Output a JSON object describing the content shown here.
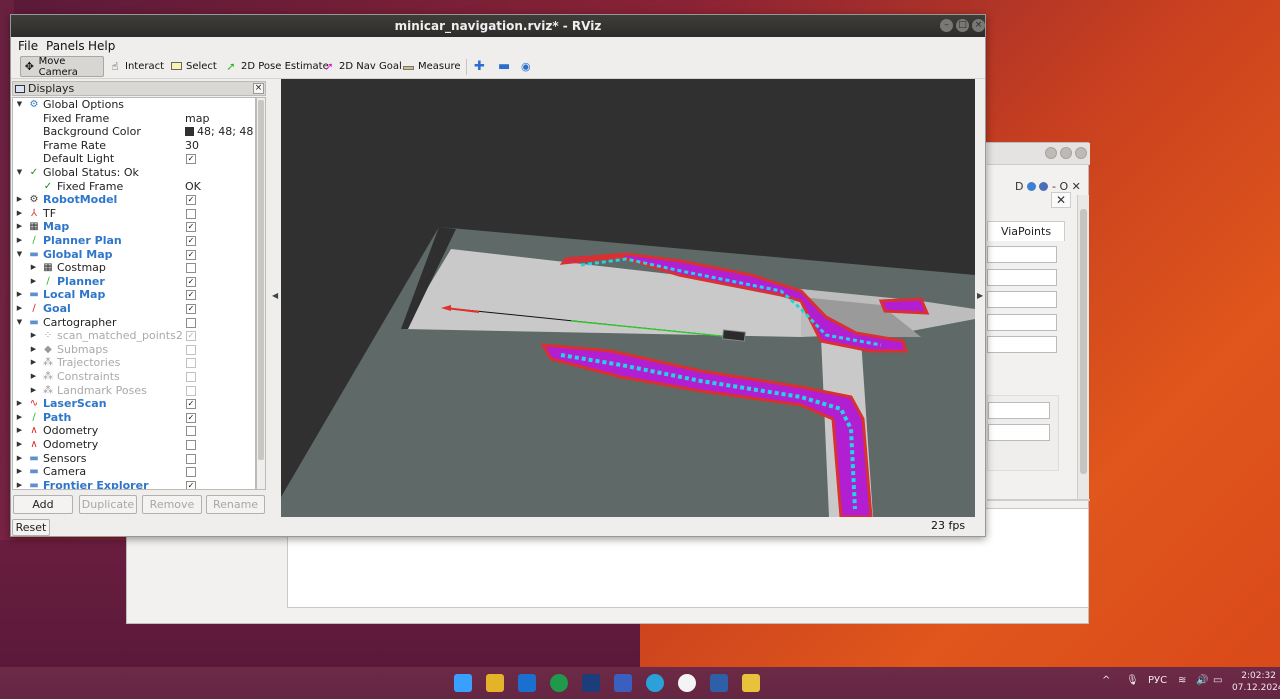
{
  "window": {
    "title": "minicar_navigation.rviz* - RViz"
  },
  "menu": [
    "File",
    "Panels",
    "Help"
  ],
  "toolbar": [
    {
      "label": "Move Camera",
      "icon": "move-camera-icon"
    },
    {
      "label": "Interact",
      "icon": "hand-icon"
    },
    {
      "label": "Select",
      "icon": "select-box-icon"
    },
    {
      "label": "2D Pose Estimate",
      "icon": "green-arrow-icon"
    },
    {
      "label": "2D Nav Goal",
      "icon": "magenta-arrow-icon"
    },
    {
      "label": "Measure",
      "icon": "ruler-icon"
    }
  ],
  "displays": {
    "title": "Displays",
    "rows": [
      {
        "name": "Global Options",
        "level": 0,
        "expanded": true,
        "icon": "gear-icon"
      },
      {
        "name": "Fixed Frame",
        "level": 1,
        "value": "map"
      },
      {
        "name": "Background Color",
        "level": 1,
        "value": "48; 48; 48",
        "swatch": "#303030"
      },
      {
        "name": "Frame Rate",
        "level": 1,
        "value": "30"
      },
      {
        "name": "Default Light",
        "level": 1,
        "check": true
      },
      {
        "name": "Global Status: Ok",
        "level": 0,
        "expanded": true,
        "icon": "checkmark-icon"
      },
      {
        "name": "Fixed Frame",
        "level": 1,
        "value": "OK",
        "icon": "checkmark-icon"
      },
      {
        "name": "RobotModel",
        "level": 0,
        "blue": true,
        "check": true,
        "icon": "robot-icon"
      },
      {
        "name": "TF",
        "level": 0,
        "check": false,
        "icon": "tf-icon"
      },
      {
        "name": "Map",
        "level": 0,
        "blue": true,
        "check": true,
        "icon": "map-icon"
      },
      {
        "name": "Planner Plan",
        "level": 0,
        "blue": true,
        "check": true,
        "icon": "path-icon"
      },
      {
        "name": "Global Map",
        "level": 0,
        "blue": true,
        "expanded": true,
        "check": true,
        "icon": "folder-icon"
      },
      {
        "name": "Costmap",
        "level": 1,
        "check": false,
        "icon": "map-icon"
      },
      {
        "name": "Planner",
        "level": 1,
        "blue": true,
        "check": true,
        "icon": "path-icon"
      },
      {
        "name": "Local Map",
        "level": 0,
        "blue": true,
        "check": true,
        "icon": "folder-icon"
      },
      {
        "name": "Goal",
        "level": 0,
        "blue": true,
        "check": true,
        "icon": "pose-icon"
      },
      {
        "name": "Cartographer",
        "level": 0,
        "expanded": true,
        "check": false,
        "icon": "folder-icon"
      },
      {
        "name": "scan_matched_points2",
        "level": 1,
        "grey": true,
        "check": true,
        "disabled": true,
        "icon": "points-icon"
      },
      {
        "name": "Submaps",
        "level": 1,
        "grey": true,
        "check": false,
        "disabled": true,
        "icon": "submap-icon"
      },
      {
        "name": "Trajectories",
        "level": 1,
        "grey": true,
        "check": false,
        "disabled": true,
        "icon": "markers-icon"
      },
      {
        "name": "Constraints",
        "level": 1,
        "grey": true,
        "check": false,
        "disabled": true,
        "icon": "markers-icon"
      },
      {
        "name": "Landmark Poses",
        "level": 1,
        "grey": true,
        "check": false,
        "disabled": true,
        "icon": "markers-icon"
      },
      {
        "name": "LaserScan",
        "level": 0,
        "blue": true,
        "check": true,
        "icon": "laserscan-icon"
      },
      {
        "name": "Path",
        "level": 0,
        "blue": true,
        "check": true,
        "icon": "path-icon"
      },
      {
        "name": "Odometry",
        "level": 0,
        "check": false,
        "icon": "odometry-icon"
      },
      {
        "name": "Odometry",
        "level": 0,
        "check": false,
        "icon": "odometry-icon"
      },
      {
        "name": "Sensors",
        "level": 0,
        "check": false,
        "icon": "folder-icon"
      },
      {
        "name": "Camera",
        "level": 0,
        "check": false,
        "icon": "folder-icon"
      },
      {
        "name": "Frontier Explorer",
        "level": 0,
        "blue": true,
        "check": true,
        "icon": "folder-icon"
      }
    ]
  },
  "buttons": {
    "add": "Add",
    "duplicate": "Duplicate",
    "remove": "Remove",
    "rename": "Rename",
    "reset": "Reset"
  },
  "status": {
    "fps": "23 fps"
  },
  "background_window": {
    "tab": "ViaPoints",
    "tools": "D",
    "close": "✕"
  },
  "taskbar": {
    "language": "РУС",
    "time": "2:02:32",
    "date": "07.12.2024"
  },
  "colors": {
    "view_background": "#303030",
    "map_free": "#c7c7c7",
    "map_unknown": "#5e6a69",
    "inflation_cyan": "#22d3e0",
    "inflation_magenta": "#b020d0",
    "obstacle_red": "#d93030",
    "path_green": "#2ad02a"
  }
}
